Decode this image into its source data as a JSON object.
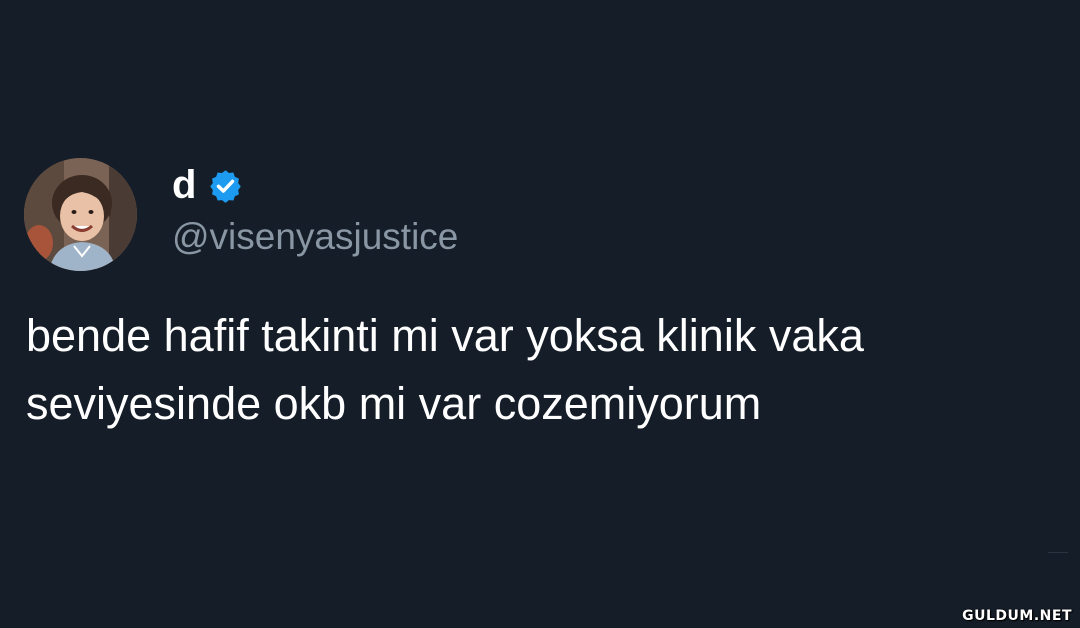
{
  "tweet": {
    "display_name": "d",
    "verified_icon": "verified-badge-icon",
    "handle": "@visenyasjustice",
    "text_lines": [
      "bende hafif takinti mi var yoksa klinik vaka",
      "seviyesinde okb mi var cozemiyorum"
    ]
  },
  "watermark": "GULDUM.NET",
  "colors": {
    "background": "#151d28",
    "name": "#ffffff",
    "handle": "#8996a3",
    "text": "#ffffff",
    "verified": "#1d9bf0"
  }
}
